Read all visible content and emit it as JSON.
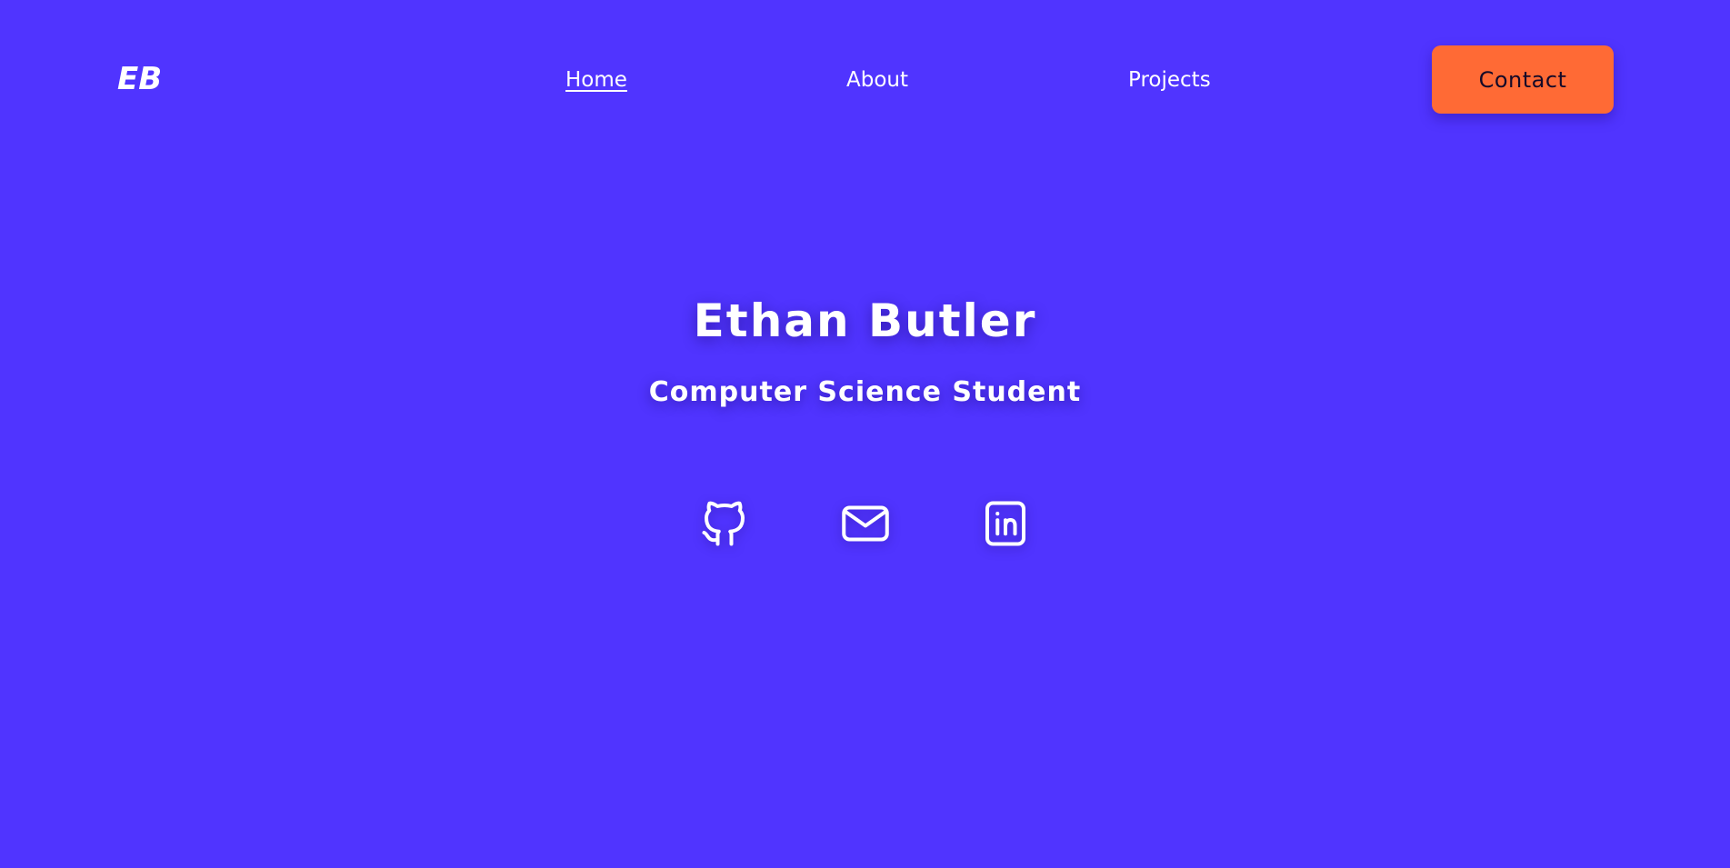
{
  "header": {
    "logo_text": "EB",
    "nav": {
      "home_label": "Home",
      "about_label": "About",
      "projects_label": "Projects"
    },
    "contact_label": "Contact"
  },
  "hero": {
    "name": "Ethan Butler",
    "subtitle": "Computer Science Student"
  },
  "socials": [
    {
      "icon": "github-icon"
    },
    {
      "icon": "mail-icon"
    },
    {
      "icon": "linkedin-icon"
    }
  ],
  "colors": {
    "background": "#5034ff",
    "accent": "#ff6a35",
    "text": "#ffffff",
    "button_text": "#140a28"
  }
}
